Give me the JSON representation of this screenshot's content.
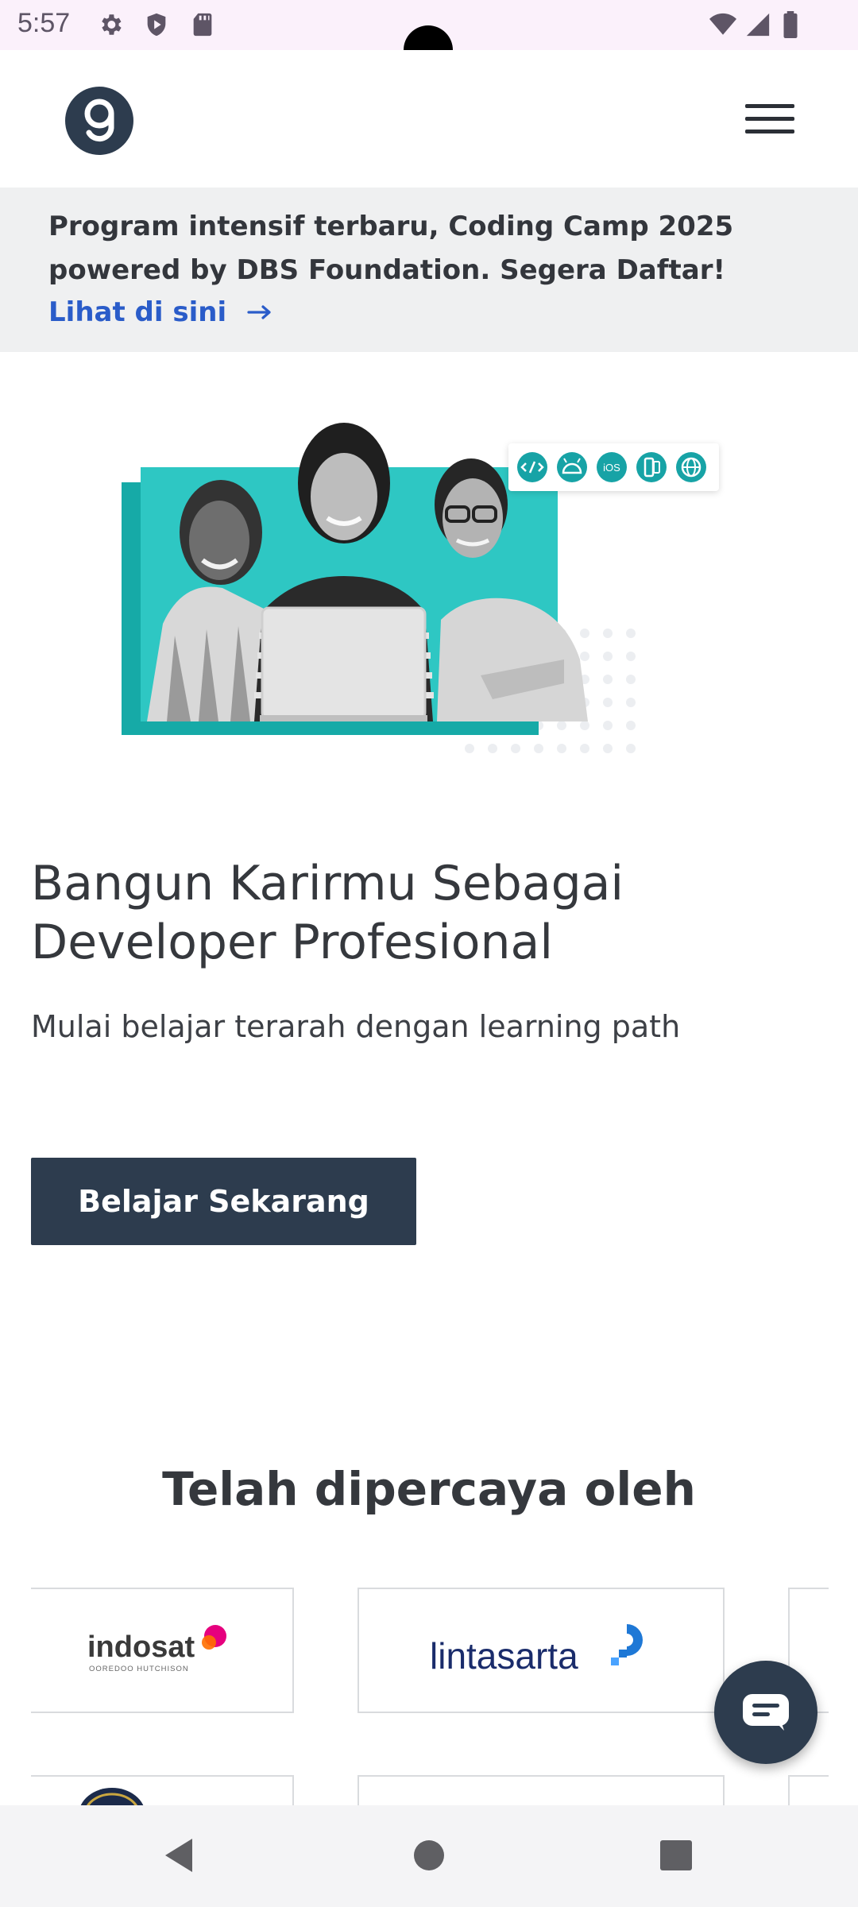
{
  "status_bar": {
    "time": "5:57",
    "icons": [
      "gear-icon",
      "shield-icon",
      "sd-card-icon",
      "wifi-icon",
      "signal-icon",
      "battery-icon"
    ]
  },
  "header": {
    "logo": "dicoding-logo",
    "menu_icon": "hamburger-menu-icon"
  },
  "announcement": {
    "text": "Program intensif terbaru, Coding Camp 2025 powered by DBS Foundation. Segera Daftar!",
    "link_label": "Lihat di sini",
    "link_color": "#2a5cc9"
  },
  "hero": {
    "badge_icons": [
      "code-icon",
      "android-icon",
      "ios-icon",
      "multiplatform-icon",
      "web-icon"
    ],
    "badge_ios_label": "iOS",
    "title": "Bangun Karirmu Sebagai Developer Profesional",
    "subtitle": "Mulai belajar terarah dengan learning path",
    "cta_label": "Belajar Sekarang",
    "accent_color": "#1cbcb8"
  },
  "trusted": {
    "title": "Telah dipercaya oleh",
    "partners": [
      {
        "name": "indosat",
        "tagline": "OOREDOO HUTCHISON"
      },
      {
        "name": "lintasarta"
      }
    ]
  },
  "chat": {
    "icon": "chat-bubble-icon"
  },
  "nav_bar": {
    "icons": [
      "back-icon",
      "home-icon",
      "recents-icon"
    ]
  },
  "colors": {
    "primary_dark": "#2d3c4e",
    "status_bar_bg": "#fbf1fb",
    "announcement_bg": "#eff0f1"
  }
}
